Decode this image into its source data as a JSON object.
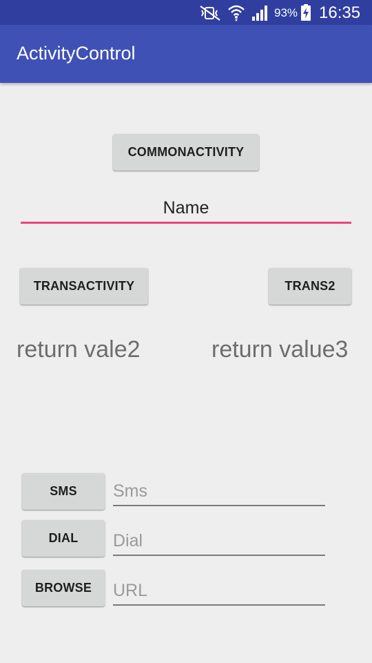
{
  "status_bar": {
    "battery_percent": "93%",
    "time": "16:35",
    "icons": [
      "mute-vibrate-icon",
      "wifi-icon",
      "signal-icon",
      "battery-charging-icon"
    ]
  },
  "app_bar": {
    "title": "ActivityControl"
  },
  "main": {
    "common_button": "COMMONACTIVITY",
    "name_field_value": "Name",
    "trans_activity_button": "TRANSACTIVITY",
    "trans2_button": "TRANS2",
    "return_value_2": "return vale2",
    "return_value_3": "return value3"
  },
  "actions": {
    "sms_button": "SMS",
    "sms_placeholder": "Sms",
    "dial_button": "DIAL",
    "dial_placeholder": "Dial",
    "browse_button": "BROWSE",
    "url_placeholder": "URL"
  },
  "colors": {
    "status_bar": "#303f9f",
    "app_bar": "#3f51b5",
    "accent": "#e8467c",
    "background": "#eeeeee",
    "button": "#d6d7d7"
  }
}
